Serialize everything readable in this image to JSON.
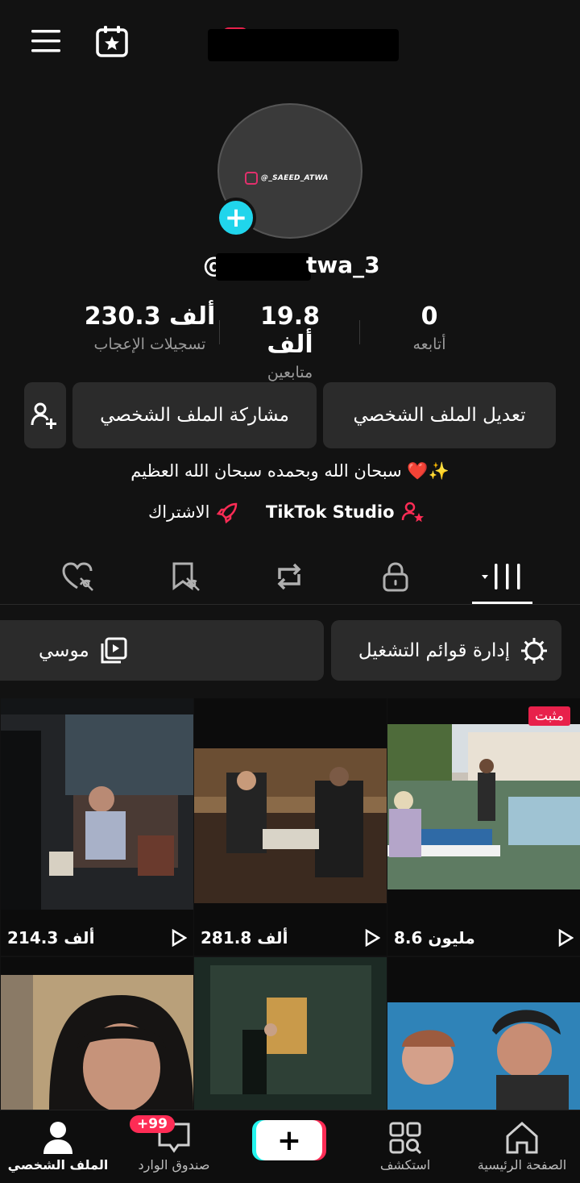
{
  "header": {
    "menu_icon": "hamburger-icon",
    "calendar_icon": "calendar-star-icon"
  },
  "profile": {
    "avatar_text": "@_SAEED_ATWA",
    "username_prefix": "@",
    "username_suffix": "twa_3"
  },
  "stats": [
    {
      "value": "0",
      "label": "أتابعه"
    },
    {
      "value": "19.8 ألف",
      "label": "متابعين"
    },
    {
      "value": "230.3 ألف",
      "label": "تسجيلات الإعجاب"
    }
  ],
  "buttons": {
    "edit_profile": "تعديل الملف الشخصي",
    "share_profile": "مشاركة الملف الشخصي"
  },
  "bio": "سبحان الله وبحمده سبحان الله العظيم ❤️✨",
  "links": {
    "studio": "TikTok Studio",
    "subscription": "الاشتراك"
  },
  "playlists": {
    "manage": "إدارة قوائم التشغيل",
    "music": "موسي"
  },
  "videos": [
    {
      "views": "8.6 مليون",
      "pinned": "مثبت"
    },
    {
      "views": "281.8 ألف"
    },
    {
      "views": "214.3 ألف"
    },
    {
      "views": ""
    },
    {
      "views": ""
    },
    {
      "views": ""
    }
  ],
  "bottom_nav": {
    "home": "الصفحة الرئيسية",
    "discover": "استكشف",
    "inbox": "صندوق الوارد",
    "inbox_badge": "+99",
    "profile": "الملف الشخصي"
  },
  "colors": {
    "accent_red": "#fe2c55",
    "accent_cyan": "#20d5ec",
    "background": "#121212"
  }
}
